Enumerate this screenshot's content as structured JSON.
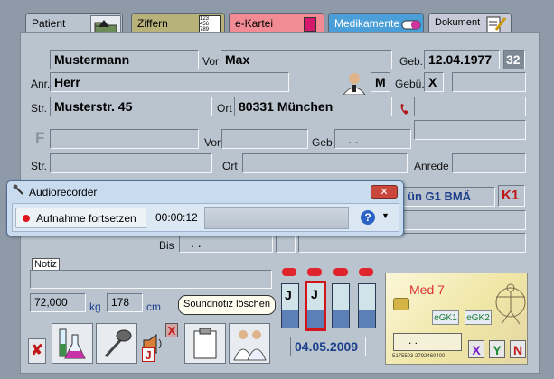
{
  "tabs": {
    "patient": "Patient",
    "patient_index": "1",
    "ziffern": "Ziffern",
    "ekartei": "e-Kartei",
    "medikamente": "Medikamente",
    "dokument": "Dokument"
  },
  "patient": {
    "lastname": "Mustermann",
    "vor_label": "Vor",
    "firstname": "Max",
    "geb_label": "Geb.",
    "birthdate": "12.04.1977",
    "age": "32",
    "anr_label": "Anr.",
    "salutation": "Herr",
    "sex": "M",
    "gebue_label": "Gebü.",
    "gebue_value": "X",
    "str_label": "Str.",
    "street": "Musterstr. 45",
    "ort_label": "Ort",
    "city": "80331 München"
  },
  "second": {
    "f_label": "F",
    "vor_label": "Vor",
    "geb_label": "Geb",
    "geb_value": ". .",
    "str_label": "Str.",
    "ort_label": "Ort",
    "anrede_label": "Anrede"
  },
  "insurance": {
    "partial": "ün G1 BMÄ",
    "k1": "K1",
    "bis_label": "Bis",
    "bis_value": ". ."
  },
  "notiz": {
    "label": "Notiz",
    "weight": "72,000",
    "kg": "kg",
    "height": "178",
    "cm": "cm"
  },
  "audio": {
    "title": "Audiorecorder",
    "record_label": "Aufnahme fortsetzen",
    "time": "00:00:12"
  },
  "tooltip": "Soundnotiz löschen",
  "bars": {
    "labels": [
      "J",
      "J",
      "",
      ""
    ],
    "fill": [
      0.4,
      0.4,
      0.4,
      0.4
    ]
  },
  "date": "04.05.2009",
  "card": {
    "title": "Med 7",
    "egk1": "eGK1",
    "egk2": "eGK2",
    "dots": ". .",
    "numbers": "5175503   2792460400",
    "x": "X",
    "y": "Y",
    "n": "N"
  },
  "bottom": {
    "j": "J",
    "x": "X"
  },
  "colors": {
    "ziffern": "#b7b27a",
    "ekartei": "#f28b93",
    "medikamente": "#4a9fd8",
    "dokument": "#c8cad8",
    "panel": "#b9c4cf",
    "accent_red": "#c01818"
  }
}
